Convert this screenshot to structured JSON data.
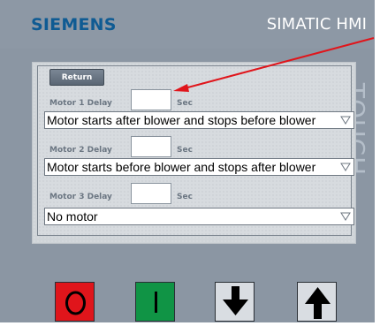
{
  "device": {
    "brand": "SIEMENS",
    "product": "SIMATIC HMI",
    "side_label": "TOUCH"
  },
  "screen": {
    "return_label": "Return",
    "rows": [
      {
        "label": "Motor 1 Delay",
        "delay_value": "",
        "unit": "Sec",
        "mode": "Motor starts after blower and stops before blower"
      },
      {
        "label": "Motor 2 Delay",
        "delay_value": "",
        "unit": "Sec",
        "mode": "Motor starts before blower and stops after blower"
      },
      {
        "label": "Motor 3 Delay",
        "delay_value": "",
        "unit": "Sec",
        "mode": "No motor"
      }
    ]
  },
  "keys": [
    {
      "name": "stop-key",
      "icon": "circle-icon",
      "color": "#e0151b"
    },
    {
      "name": "start-key",
      "icon": "bar-icon",
      "color": "#109445"
    },
    {
      "name": "down-key",
      "icon": "arrow-down-icon",
      "color": "#d9dde2"
    },
    {
      "name": "up-key",
      "icon": "arrow-up-icon",
      "color": "#d9dde2"
    }
  ],
  "colors": {
    "bezel": "#8b96a3",
    "brand_text": "#0f5b93",
    "annotation_arrow": "#e0151b"
  }
}
